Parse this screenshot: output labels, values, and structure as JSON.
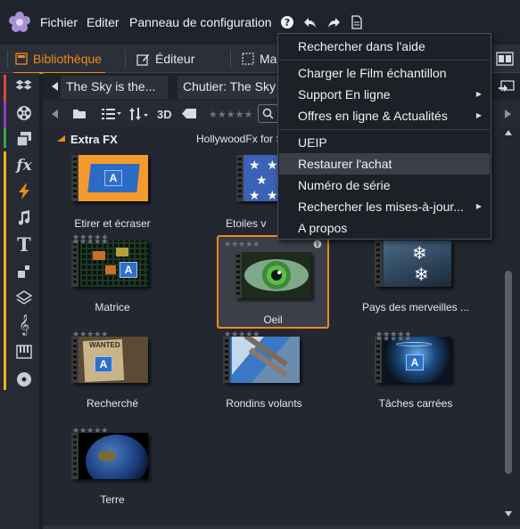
{
  "menubar": {
    "fichier": "Fichier",
    "editer": "Editer",
    "panneau": "Panneau de configuration"
  },
  "tabs": {
    "bibliotheque": "Bibliothèque",
    "editeur": "Éditeur",
    "masque": "Mas"
  },
  "collections": {
    "tab1": "The Sky is the...",
    "tab2": "Chutier: The Sky i"
  },
  "toolbar": {
    "three_d": "3D",
    "rating": "★★★★★"
  },
  "group": {
    "title": "Extra FX",
    "right_label": "HollywoodFx for S"
  },
  "items": [
    {
      "label": "Etirer et écraser",
      "stars": "★★★★★"
    },
    {
      "label": "Etoiles v",
      "stars": "★★★★★"
    },
    {
      "label": "Matrice",
      "stars": "★★★★★"
    },
    {
      "label": "Oeil",
      "stars": "★★★★★"
    },
    {
      "label": "Pays des merveilles ...",
      "stars": "★★★★★"
    },
    {
      "label": "Recherché",
      "stars": "★★★★★"
    },
    {
      "label": "Rondins volants",
      "stars": "★★★★★"
    },
    {
      "label": "Tâches carrées",
      "stars": "★★★★★"
    },
    {
      "label": "Terre",
      "stars": "★★★★★"
    }
  ],
  "thumb_text": {
    "a": "A",
    "wanted": "WANTED"
  },
  "dropdown": {
    "items": [
      {
        "label": "Rechercher dans l'aide",
        "submenu": false
      },
      {
        "label": "Charger le Film échantillon",
        "submenu": false
      },
      {
        "label": "Support En ligne",
        "submenu": true
      },
      {
        "label": "Offres en ligne & Actualités",
        "submenu": true
      },
      {
        "label": "UEIP",
        "submenu": false
      },
      {
        "label": "Restaurer l'achat",
        "submenu": false,
        "highlighted": true
      },
      {
        "label": "Numéro de série",
        "submenu": false
      },
      {
        "label": "Rechercher les mises-à-jour...",
        "submenu": true
      },
      {
        "label": "A propos",
        "submenu": false
      }
    ]
  },
  "colors": {
    "accent": "#f08a1a",
    "rail_colors": [
      "#d94a3a",
      "#8a3fc4",
      "#3aa84a",
      "#f0b21a"
    ]
  },
  "icons": [
    "help-icon",
    "undo-icon",
    "redo-icon",
    "document-icon",
    "dropbox-icon",
    "film-reel-icon",
    "stack-icon",
    "fx-icon",
    "lightning-icon",
    "music-note-icon",
    "text-icon",
    "puzzle-icon",
    "layers-icon",
    "treble-clef-icon",
    "piano-icon",
    "disc-icon"
  ]
}
